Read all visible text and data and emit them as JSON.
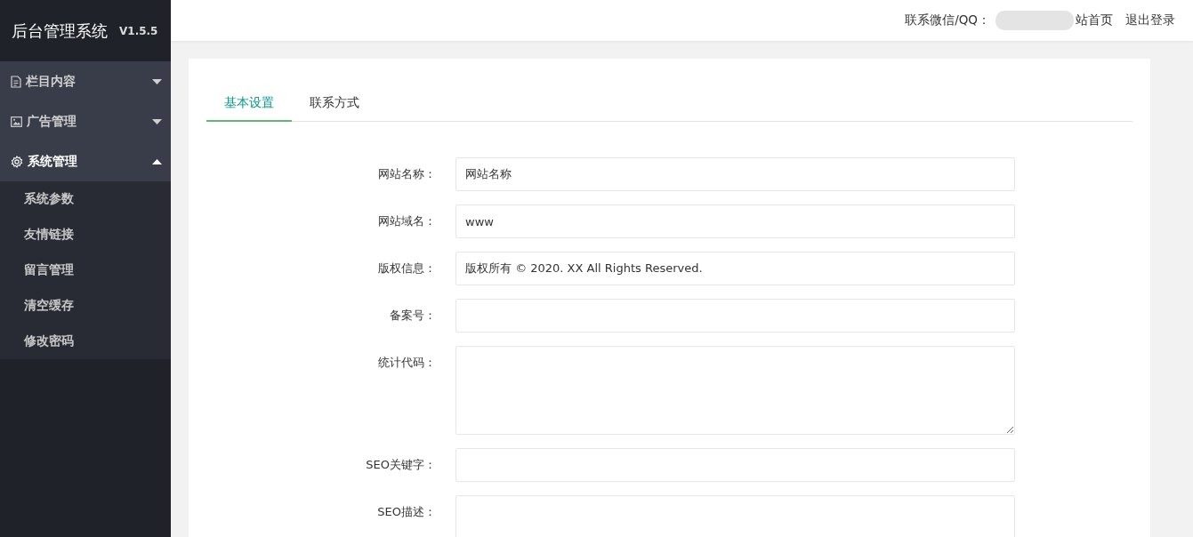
{
  "sidebar": {
    "title": "后台管理系统",
    "version": "V1.5.5",
    "items": [
      {
        "kind": "document",
        "label": "栏目内容",
        "expanded": false
      },
      {
        "kind": "image",
        "label": "广告管理",
        "expanded": false
      },
      {
        "kind": "gear",
        "label": "系统管理",
        "expanded": true,
        "children": [
          {
            "label": "系统参数"
          },
          {
            "label": "友情链接"
          },
          {
            "label": "留言管理"
          },
          {
            "label": "清空缓存"
          },
          {
            "label": "修改密码"
          }
        ]
      }
    ]
  },
  "header": {
    "contact_label": "联系微信/QQ：",
    "links": [
      "站首页",
      "退出登录"
    ]
  },
  "tabs": [
    {
      "label": "基本设置",
      "selected": true
    },
    {
      "label": "联系方式",
      "selected": false
    }
  ],
  "form": {
    "fields": [
      {
        "kind": "input",
        "label": "网站名称：",
        "value": "网站名称"
      },
      {
        "kind": "input",
        "label": "网站域名：",
        "value": "www"
      },
      {
        "kind": "input",
        "label": "版权信息：",
        "value": "版权所有 © 2020. XX All Rights Reserved."
      },
      {
        "kind": "input",
        "label": "备案号："
      },
      {
        "kind": "textarea",
        "label": "统计代码："
      },
      {
        "kind": "input",
        "label": "SEO关键字："
      },
      {
        "kind": "textarea",
        "label": "SEO描述："
      }
    ]
  }
}
